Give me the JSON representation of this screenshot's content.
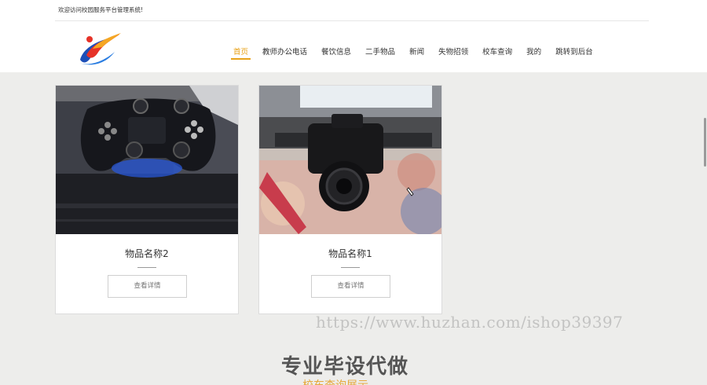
{
  "header": {
    "welcome": "欢迎访问校园服务平台管理系统!"
  },
  "nav": {
    "items": [
      "首页",
      "教师办公电话",
      "餐饮信息",
      "二手物品",
      "新闻",
      "失物招领",
      "校车查询",
      "我的",
      "跳转到后台"
    ],
    "active_index": 0
  },
  "products": [
    {
      "name": "物品名称2",
      "button": "查看详情",
      "image": "game-console-photo"
    },
    {
      "name": "物品名称1",
      "button": "查看详情",
      "image": "camera-photo"
    }
  ],
  "overlay": {
    "url_watermark": "https://www.huzhan.com/ishop39397",
    "big_text": "专业毕设代做",
    "sub_text": "校车查询展示"
  },
  "colors": {
    "accent": "#e8a21a",
    "page_bg": "#ededeb"
  }
}
